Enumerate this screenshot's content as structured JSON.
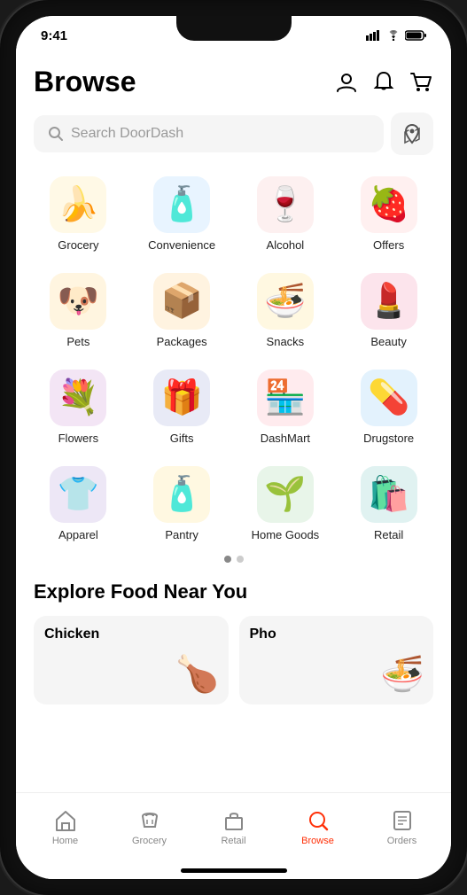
{
  "status_bar": {
    "time": "9:41"
  },
  "header": {
    "title": "Browse",
    "account_icon": "account",
    "notification_icon": "bell",
    "cart_icon": "cart"
  },
  "search": {
    "placeholder": "Search DoorDash",
    "map_icon": "map"
  },
  "categories": [
    {
      "id": "grocery",
      "label": "Grocery",
      "emoji": "🍌",
      "bg": "icon-grocery"
    },
    {
      "id": "convenience",
      "label": "Convenience",
      "emoji": "🧴",
      "bg": "icon-convenience"
    },
    {
      "id": "alcohol",
      "label": "Alcohol",
      "emoji": "🍷",
      "bg": "icon-alcohol"
    },
    {
      "id": "offers",
      "label": "Offers",
      "emoji": "🍓",
      "bg": "icon-offers"
    },
    {
      "id": "pets",
      "label": "Pets",
      "emoji": "🐶",
      "bg": "icon-pets"
    },
    {
      "id": "packages",
      "label": "Packages",
      "emoji": "📦",
      "bg": "icon-packages"
    },
    {
      "id": "snacks",
      "label": "Snacks",
      "emoji": "🍜",
      "bg": "icon-snacks"
    },
    {
      "id": "beauty",
      "label": "Beauty",
      "emoji": "💄",
      "bg": "icon-beauty"
    },
    {
      "id": "flowers",
      "label": "Flowers",
      "emoji": "💐",
      "bg": "icon-flowers"
    },
    {
      "id": "gifts",
      "label": "Gifts",
      "emoji": "🎁",
      "bg": "icon-gifts"
    },
    {
      "id": "dashmart",
      "label": "DashMart",
      "emoji": "🏪",
      "bg": "icon-dashmart"
    },
    {
      "id": "drugstore",
      "label": "Drugstore",
      "emoji": "💊",
      "bg": "icon-drugstore"
    },
    {
      "id": "apparel",
      "label": "Apparel",
      "emoji": "👕",
      "bg": "icon-apparel"
    },
    {
      "id": "pantry",
      "label": "Pantry",
      "emoji": "🧴",
      "bg": "icon-pantry"
    },
    {
      "id": "homegoods",
      "label": "Home Goods",
      "emoji": "🌱",
      "bg": "icon-homegoods"
    },
    {
      "id": "retail",
      "label": "Retail",
      "emoji": "🛍️",
      "bg": "icon-retail"
    }
  ],
  "page_dots": [
    {
      "active": true
    },
    {
      "active": false
    }
  ],
  "explore": {
    "title": "Explore Food Near You",
    "cards": [
      {
        "id": "chicken",
        "label": "Chicken",
        "emoji": "🍗"
      },
      {
        "id": "pho",
        "label": "Pho",
        "emoji": "🍜"
      }
    ]
  },
  "bottom_nav": [
    {
      "id": "home",
      "label": "Home",
      "active": false
    },
    {
      "id": "grocery",
      "label": "Grocery",
      "active": false
    },
    {
      "id": "retail",
      "label": "Retail",
      "active": false
    },
    {
      "id": "browse",
      "label": "Browse",
      "active": true
    },
    {
      "id": "orders",
      "label": "Orders",
      "active": false
    }
  ]
}
